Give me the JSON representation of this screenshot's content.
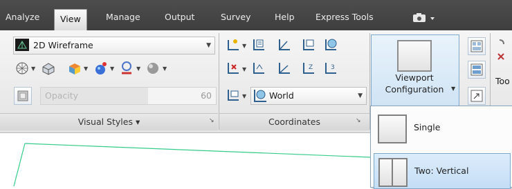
{
  "tabs": [
    {
      "label": "Analyze"
    },
    {
      "label": "View"
    },
    {
      "label": "Manage"
    },
    {
      "label": "Output"
    },
    {
      "label": "Survey"
    },
    {
      "label": "Help"
    },
    {
      "label": "Express Tools"
    }
  ],
  "visual_styles": {
    "style_value": "2D Wireframe",
    "opacity_placeholder": "Opacity",
    "opacity_value": "60",
    "panel_title": "Visual Styles ▾"
  },
  "coordinates": {
    "ucs_value": "World",
    "panel_title": "Coordinates"
  },
  "viewports": {
    "line1": "Viewport",
    "line2": "Configuration"
  },
  "partial_panel": {
    "label": "Too"
  },
  "viewport_menu": {
    "items": [
      {
        "label": "Single"
      },
      {
        "label": "Two: Vertical"
      }
    ]
  },
  "colors": {
    "tabbar": "#444444",
    "ribbon": "#eeeeee",
    "highlight": "#cfe4f7",
    "drawing_line": "#33cc88"
  }
}
